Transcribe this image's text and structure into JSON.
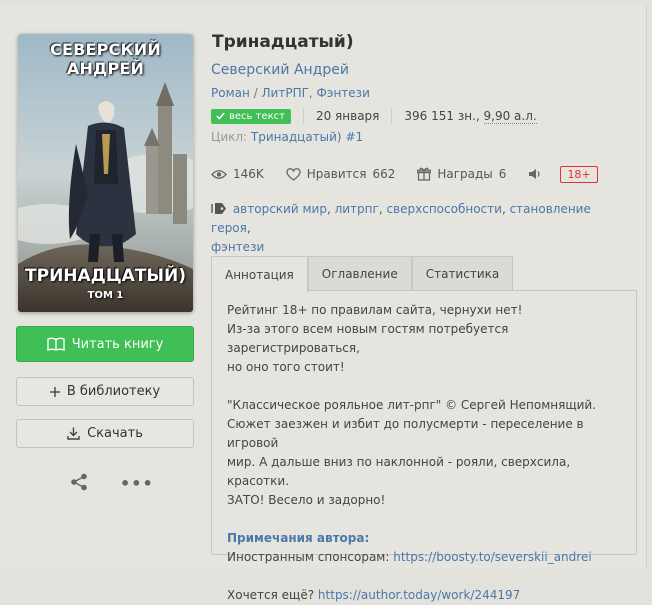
{
  "cover": {
    "author_text": "СЕВЕРСКИЙ АНДРЕЙ",
    "title_text": "ТРИНАДЦАТЫЙ)",
    "volume_text": "ТОМ 1"
  },
  "actions": {
    "read_label": "Читать книгу",
    "library_label": "В библиотеку",
    "download_label": "Скачать",
    "more_label": "•••"
  },
  "book": {
    "title": "Тринадцатый)",
    "author": "Северский Андрей",
    "genres": [
      "Роман",
      "ЛитРПГ",
      "Фэнтези"
    ],
    "status_badge": "весь текст",
    "date": "20 января",
    "size_chars": "396 151 зн., ",
    "size_al": "9,90 а.л.",
    "cycle_label": "Цикл:",
    "cycle_name": "Тринадцатый)",
    "cycle_number": "#1"
  },
  "stats": {
    "views": "146K",
    "likes_label": "Нравится",
    "likes_count": "662",
    "awards_label": "Награды",
    "awards_count": "6",
    "age_rating": "18+"
  },
  "tags": [
    "авторский мир",
    "литрпг",
    "сверхспособности",
    "становление героя",
    "фэнтези"
  ],
  "tabs": [
    "Аннотация",
    "Оглавление",
    "Статистика"
  ],
  "annotation": {
    "line1": "Рейтинг 18+ по правилам сайта, чернухи нет!",
    "line2": "Из-за этого всем новым гостям потребуется зарегистрироваться,",
    "line3": "но оно того стоит!",
    "line4": "\"Классическое рояльное лит-рпг\" © Сергей Непомнящий.",
    "line5": "Сюжет заезжен и избит до полусмерти - переселение в игровой",
    "line6": "мир. А дальше вниз по наклонной - рояли, сверхсила, красотки.",
    "line7": "ЗАТО! Весело и задорно!",
    "notes_heading": "Примечания автора:",
    "sponsors_label": "Иностранным спонсорам: ",
    "sponsors_link": "https://boosty.to/severskii_andrei",
    "more_label": "Хочется ещё? ",
    "more_link": "https://author.today/work/244197"
  },
  "colors": {
    "accent_green": "#3fbf55",
    "link_blue": "#4a78a8",
    "age_red": "#d33333"
  }
}
